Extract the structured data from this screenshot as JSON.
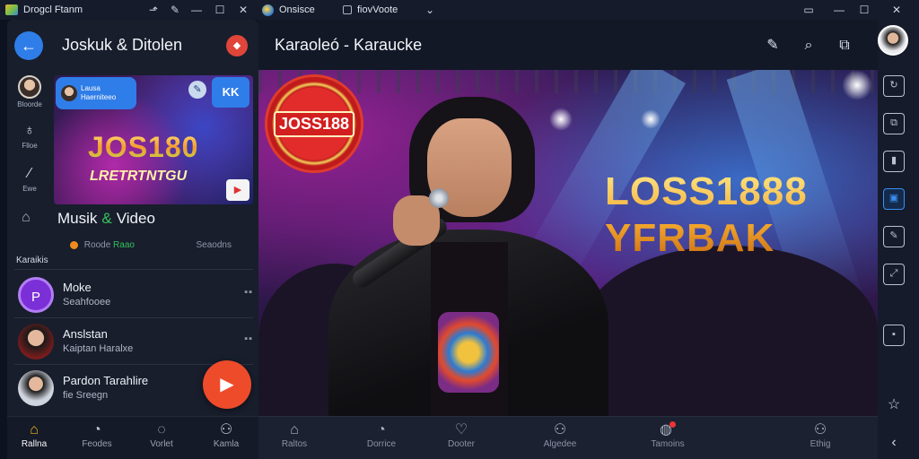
{
  "titlebar": {
    "tabs": [
      {
        "label": "Drogcl Ftanm"
      },
      {
        "label": "Onsisce"
      },
      {
        "label": "fiovVoote"
      }
    ],
    "icons": [
      "tab-action-icon",
      "tab-edit-icon",
      "minimize-icon",
      "maximize-icon",
      "close-icon"
    ]
  },
  "sidebar": {
    "title": "Joskuk & Ditolen",
    "rail": [
      {
        "label": "Bloorde"
      },
      {
        "label": "Flloe"
      },
      {
        "label": "Ewe"
      }
    ],
    "banner": {
      "chip_line1": "Lausa",
      "chip_line2": "Haerniteeo",
      "badge": "KK",
      "big": "JOS180",
      "sub": "LRETRTNTGU"
    },
    "section_title_a": "Musik",
    "section_title_amp": "&",
    "section_title_b": "Video",
    "meta_left": "Roode",
    "meta_green": "Raao",
    "meta_right": "Seaodns",
    "list_label": "Karaikis",
    "songs": [
      {
        "title": "Moke",
        "subtitle": "Seahfooee",
        "initial": "P",
        "more": "▪▪"
      },
      {
        "title": "Anslstan",
        "subtitle": "Kaiptan Haralxe",
        "more": "▪▪"
      },
      {
        "title": "Pardon Tarahlire",
        "subtitle": "fie Sreegn"
      }
    ],
    "nav": [
      {
        "label": "Rallna"
      },
      {
        "label": "Feodes"
      },
      {
        "label": "Vorlet"
      },
      {
        "label": "Kamla"
      }
    ]
  },
  "main": {
    "title": "Karaoleó - Karaucke",
    "seal_text": "JOSS188",
    "promo_line1": "LOSS1888",
    "promo_line2": "YFRBAK",
    "nav": [
      {
        "label": "Raltos"
      },
      {
        "label": "Dorrice"
      },
      {
        "label": "Dooter"
      },
      {
        "label": "Algedee"
      },
      {
        "label": "Tamoins"
      },
      {
        "label": "Ethig"
      }
    ]
  },
  "colors": {
    "accent": "#2f7de8",
    "fab": "#ee4b2b",
    "active_nav": "#f3b322",
    "seal": "#e22c2c"
  }
}
